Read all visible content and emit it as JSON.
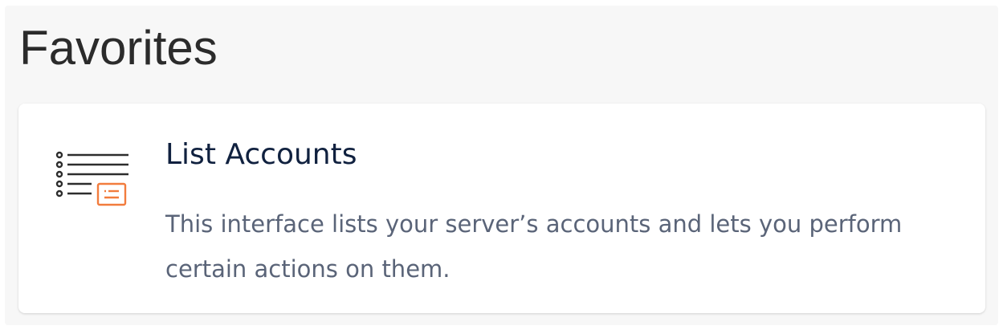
{
  "section": {
    "title": "Favorites"
  },
  "favorites": [
    {
      "title": "List Accounts",
      "description": "This interface lists your server’s accounts and lets you perform certain actions on them.",
      "icon": "list-accounts-icon"
    }
  ],
  "colors": {
    "section_background": "#f7f7f7",
    "card_background": "#ffffff",
    "title_text": "#2b2b2b",
    "card_title_text": "#10213f",
    "description_text": "#5a6478",
    "icon_accent": "#f27c3d",
    "icon_lines": "#2d2d2d"
  }
}
